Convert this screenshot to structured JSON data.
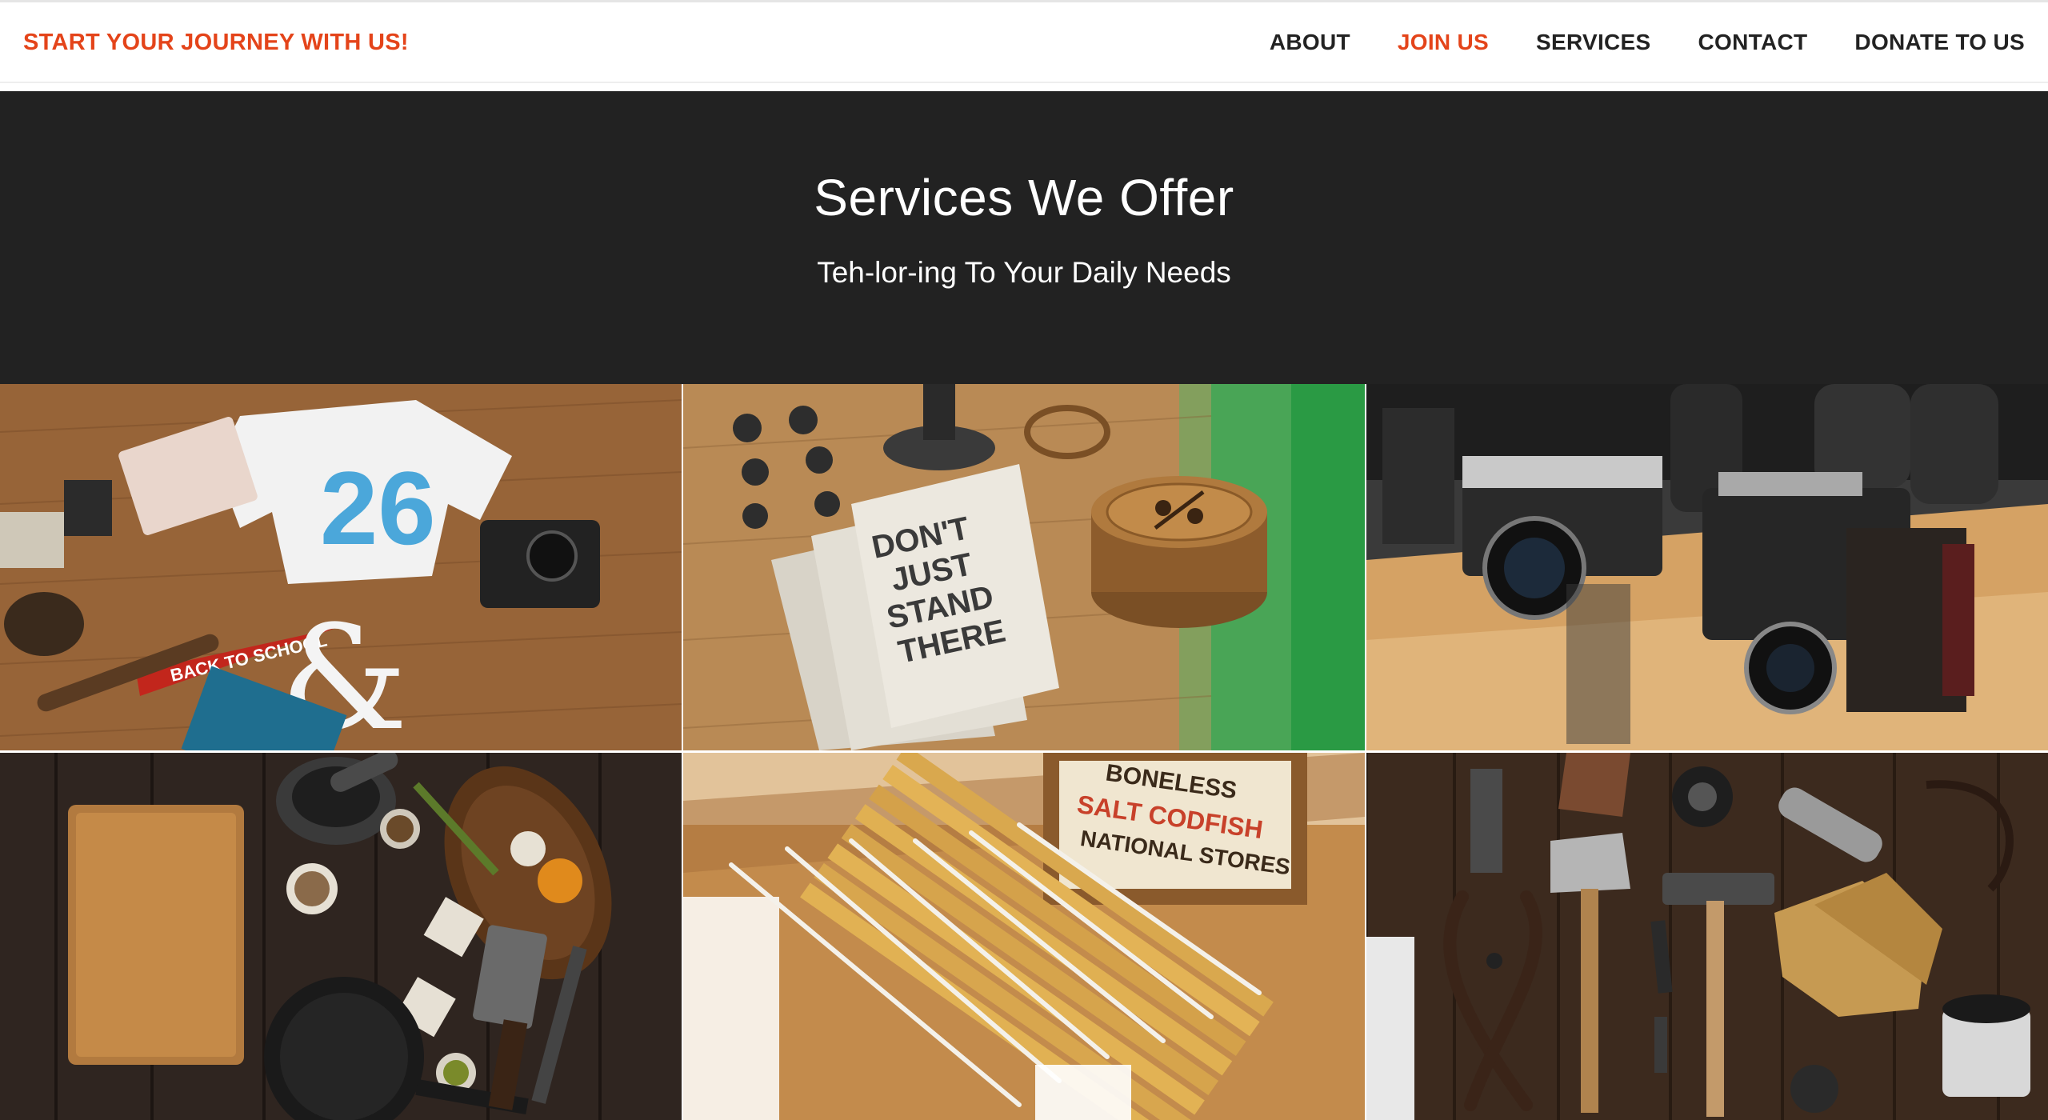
{
  "navbar": {
    "brand": "START YOUR JOURNEY WITH US!",
    "links": [
      {
        "label": "ABOUT",
        "active": false
      },
      {
        "label": "JOIN US",
        "active": true
      },
      {
        "label": "SERVICES",
        "active": false
      },
      {
        "label": "CONTACT",
        "active": false
      },
      {
        "label": "DONATE TO US",
        "active": false
      }
    ],
    "accent_color": "#e4441a"
  },
  "hero": {
    "title": "Services We Offer",
    "subtitle": "Teh-lor-ing To Your Daily Needs",
    "background": "#222222"
  },
  "gallery": {
    "tiles": [
      {
        "name": "workspace-desk-photo",
        "texts": [
          "26",
          "BACK TO SCHOOL"
        ]
      },
      {
        "name": "notebooks-coasters-photo",
        "texts": [
          "DON'T",
          "JUST",
          "STAND",
          "THERE"
        ]
      },
      {
        "name": "vintage-cameras-photo",
        "texts": []
      },
      {
        "name": "kitchen-cutting-board-photo",
        "texts": []
      },
      {
        "name": "folding-rulers-photo",
        "texts": [
          "BONELESS",
          "SALT CODFISH",
          "NATIONAL STORES"
        ]
      },
      {
        "name": "vintage-tools-photo",
        "texts": []
      }
    ]
  }
}
